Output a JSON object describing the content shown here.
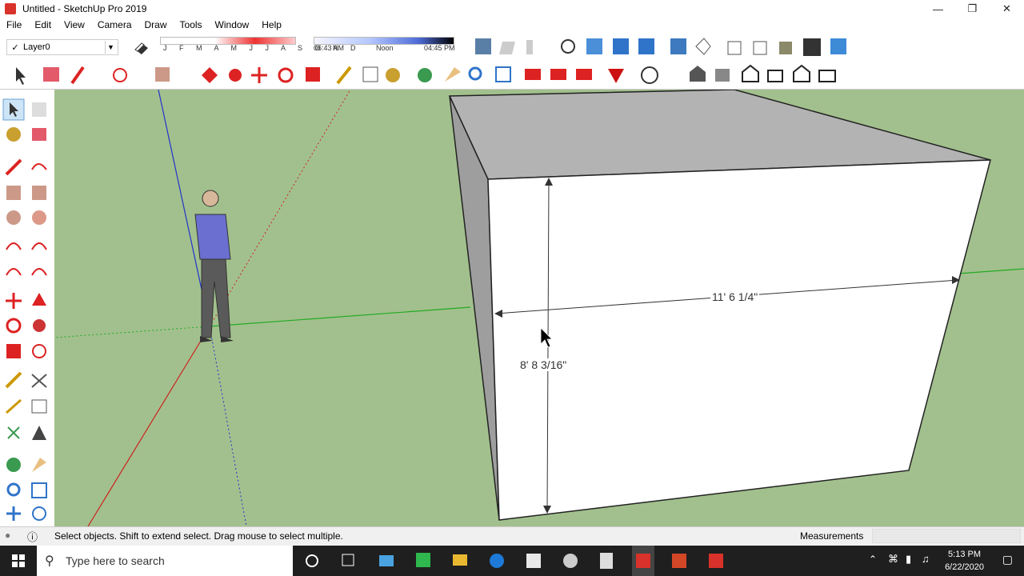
{
  "window": {
    "title": "Untitled - SketchUp Pro 2019"
  },
  "menu": [
    "File",
    "Edit",
    "View",
    "Camera",
    "Draw",
    "Tools",
    "Window",
    "Help"
  ],
  "layer": {
    "selected": "Layer0"
  },
  "shadows": {
    "months": "J F M A M J J A S O N D",
    "time_start": "06:43 AM",
    "time_mid": "Noon",
    "time_end": "04:45 PM"
  },
  "dimensions": {
    "width": "11' 6 1/4\"",
    "height": "8' 8 3/16\""
  },
  "status": {
    "hint": "Select objects. Shift to extend select. Drag mouse to select multiple.",
    "measurements_label": "Measurements"
  },
  "taskbar": {
    "search_placeholder": "Type here to search",
    "time": "5:13 PM",
    "date": "6/22/2020"
  },
  "colors": {
    "viewport_bg": "#a2c08d",
    "accent": "#d8322a"
  }
}
